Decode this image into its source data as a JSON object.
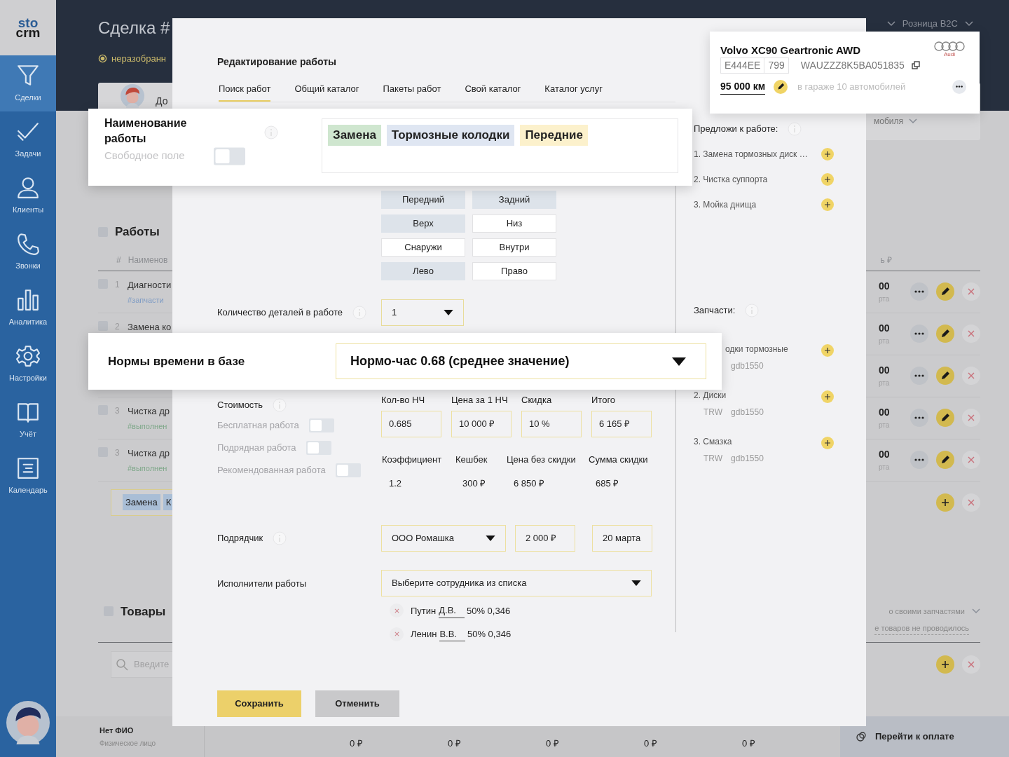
{
  "sidebar": {
    "logo": [
      "sto",
      "crm"
    ],
    "items": [
      {
        "label": "Сделки",
        "selected": true
      },
      {
        "label": "Задачи",
        "selected": false
      },
      {
        "label": "Клиенты",
        "selected": false
      },
      {
        "label": "Звонки",
        "selected": false
      },
      {
        "label": "Аналитика",
        "selected": false
      },
      {
        "label": "Настройки",
        "selected": false
      },
      {
        "label": "Учёт",
        "selected": false
      },
      {
        "label": "Календарь",
        "selected": false
      }
    ]
  },
  "header": {
    "title": "Сделка #",
    "status": "неразобранн",
    "filter": "Розница B2C"
  },
  "deal_card": {
    "client": "До",
    "car_hint": "мобиля"
  },
  "works": {
    "title": "Работы",
    "checked": false,
    "columns": [
      "#",
      "Наименов"
    ],
    "last_column": "ь ₽",
    "rows": [
      {
        "checked": false,
        "number": "1",
        "name": "Диагности",
        "tag": "#запчасти",
        "color": "#7f9cc4",
        "amount": "00",
        "date": "рта"
      },
      {
        "checked": false,
        "number": "2",
        "name": "Замена ко",
        "amount": "00",
        "date": "рта"
      },
      {
        "amount": "00",
        "date": "рта"
      },
      {
        "checked": false,
        "number": "3",
        "name": "Чистка др",
        "tag": "#выполнен",
        "color": "#7fa88a",
        "amount": "00",
        "date": "рта"
      },
      {
        "checked": false,
        "number": "3",
        "name": "Чистка др",
        "tag": "#выполнен",
        "color": "#7fa88a",
        "amount": "00",
        "date": "рта"
      }
    ],
    "new_row_tags": [
      "Замена",
      "К"
    ]
  },
  "goods": {
    "title": "Товары",
    "checked": false,
    "mode": "о своими запчастями",
    "note": "е товаров не проводилось",
    "search_placeholder": "Введите"
  },
  "footer": {
    "client_name": "Нет ФИО",
    "client_type": "Физическое лицо",
    "totals": [
      "0 ₽",
      "0 ₽",
      "0 ₽",
      "0 ₽",
      "0 ₽"
    ],
    "pay_button": "Перейти к оплате"
  },
  "modal": {
    "title": "Редактирование работы",
    "tabs": [
      {
        "label": "Поиск работ",
        "selected": true
      },
      {
        "label": "Общий каталог",
        "selected": false
      },
      {
        "label": "Пакеты работ",
        "selected": false
      },
      {
        "label": "Свой каталог",
        "selected": false
      },
      {
        "label": "Каталог услуг",
        "selected": false
      }
    ],
    "positions": [
      {
        "label": "Передний",
        "selected": true
      },
      {
        "label": "Задний",
        "selected": true
      },
      {
        "label": "Верх",
        "selected": true
      },
      {
        "label": "Низ",
        "selected": false
      },
      {
        "label": "Снаружи",
        "selected": false
      },
      {
        "label": "Внутри",
        "selected": false
      },
      {
        "label": "Лево",
        "selected": true
      },
      {
        "label": "Право",
        "selected": false
      }
    ],
    "quantity": {
      "label": "Количество деталей в работе",
      "value": "1"
    },
    "cost": {
      "label": "Стоимость",
      "toggles": [
        {
          "label": "Бесплатная работа",
          "on": false
        },
        {
          "label": "Подрядная работа",
          "on": false
        },
        {
          "label": "Рекомендованная работа",
          "on": false
        }
      ],
      "fields": [
        {
          "label": "Кол-во НЧ",
          "value": "0.685"
        },
        {
          "label": "Цена за 1 НЧ",
          "value": "10 000 ₽"
        },
        {
          "label": "Скидка",
          "value": "10 %"
        },
        {
          "label": "Итого",
          "value": "6 165 ₽"
        }
      ],
      "readouts": [
        {
          "label": "Коэффициент",
          "value": "1.2"
        },
        {
          "label": "Кешбек",
          "value": "300 ₽"
        },
        {
          "label": "Цена без скидки",
          "value": "6 850 ₽"
        },
        {
          "label": "Сумма скидки",
          "value": "685 ₽"
        }
      ]
    },
    "contractor": {
      "label": "Подрядчик",
      "value": "ООО Ромашка",
      "price": "2 000 ₽",
      "date": "20 марта"
    },
    "performers": {
      "label": "Исполнители работы",
      "placeholder": "Выберите сотрудника из списка",
      "people": [
        {
          "surname": "Путин",
          "initials": "Д.В.",
          "share": "50% 0,346"
        },
        {
          "surname": "Ленин",
          "initials": "В.В.",
          "share": "50% 0,346"
        }
      ]
    },
    "buttons": {
      "save": "Сохранить",
      "cancel": "Отменить"
    },
    "suggestions": {
      "title": "Предложи к работе:",
      "items": [
        "1. Замена тормозных диск …",
        "2. Чистка суппорта",
        "3. Мойка днища"
      ]
    },
    "parts": {
      "title": "Запчасти:",
      "items": [
        {
          "kind": "clipped",
          "name": "одки тормозные",
          "code": "gdb1550"
        },
        {
          "kind": "full",
          "name": "2. Диски",
          "brand": "TRW",
          "code": "gdb1550"
        },
        {
          "kind": "full",
          "name": "3. Смазка",
          "brand": "TRW",
          "code": "gdb1550"
        }
      ]
    }
  },
  "name_strip": {
    "label": "Наименование работы",
    "free_field": {
      "label": "Свободное поле",
      "on": false
    },
    "chips": [
      {
        "text": "Замена",
        "color": "#cfe6cf"
      },
      {
        "text": "Тормозные колодки",
        "color": "#dfe6f2"
      },
      {
        "text": "Передние",
        "color": "#fcf1cc"
      }
    ]
  },
  "norms_strip": {
    "label": "Нормы времени в базе",
    "value": "Нормо-час 0.68 (среднее значение)"
  },
  "car_card": {
    "model": "Volvo XC90 Geartronic AWD",
    "plate": "E444EE",
    "region": "799",
    "vin": "WAUZZZ8K5BA051835",
    "mileage": "95 000 км",
    "garage": "в гараже 10 автомобилей",
    "brand_label": "Audi"
  }
}
